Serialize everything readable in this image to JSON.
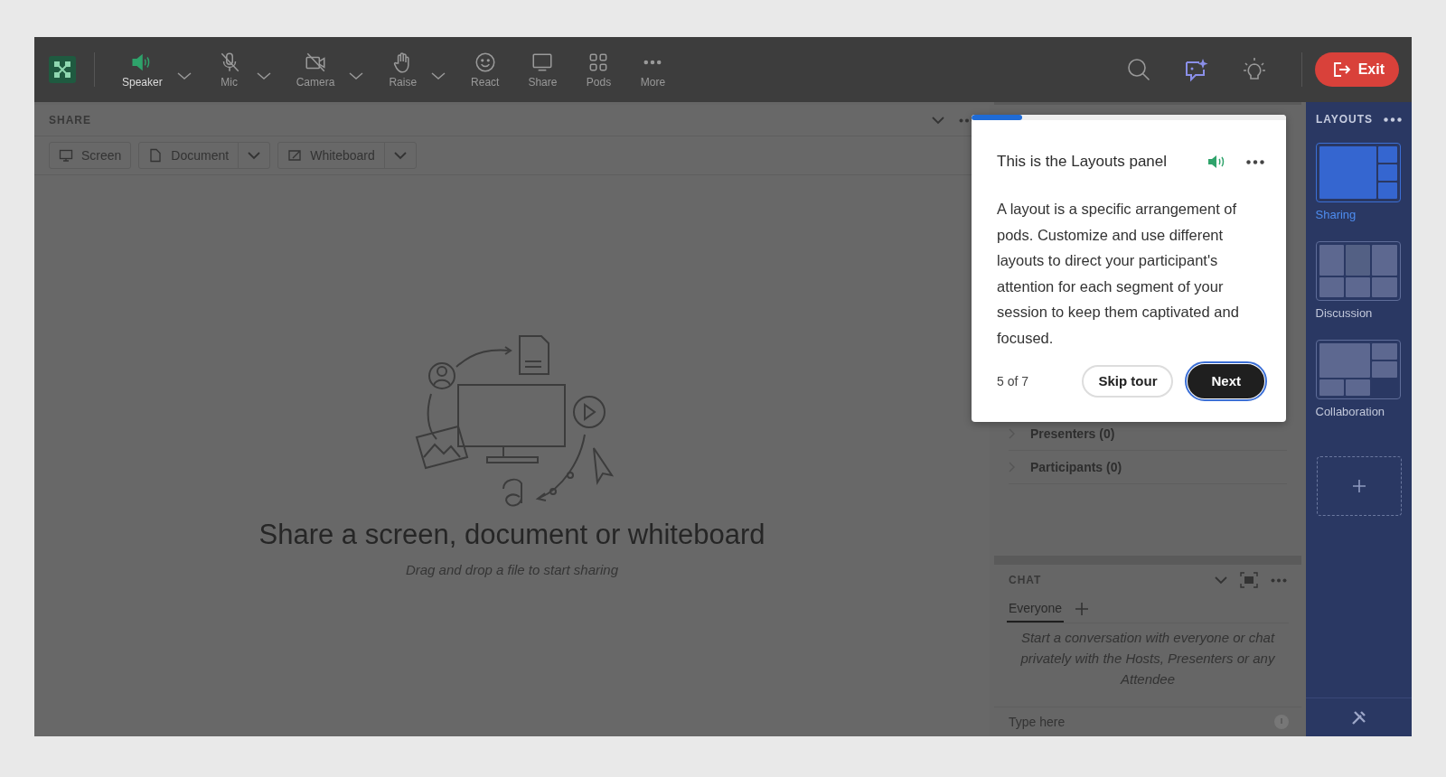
{
  "toolbar": {
    "items": [
      {
        "label": "Speaker",
        "kind": "speaker",
        "on": true,
        "dropdown": true
      },
      {
        "label": "Mic",
        "kind": "mic",
        "on": false,
        "dropdown": true
      },
      {
        "label": "Camera",
        "kind": "camera",
        "on": false,
        "dropdown": true
      },
      {
        "label": "Raise",
        "kind": "raise",
        "dropdown": true
      },
      {
        "label": "React",
        "kind": "react",
        "dropdown": false
      },
      {
        "label": "Share",
        "kind": "share",
        "dropdown": false
      },
      {
        "label": "Pods",
        "kind": "pods",
        "dropdown": false
      },
      {
        "label": "More",
        "kind": "more",
        "dropdown": false
      }
    ],
    "exit_button": "Exit"
  },
  "share_pod": {
    "title": "SHARE",
    "buttons": [
      {
        "label": "Screen",
        "kind": "monitor",
        "dropdown": false
      },
      {
        "label": "Document",
        "kind": "document",
        "dropdown": true
      },
      {
        "label": "Whiteboard",
        "kind": "whiteboard",
        "dropdown": true
      }
    ],
    "heading": "Share a screen, document or whiteboard",
    "hint": "Drag and drop a file to start sharing"
  },
  "attendees": {
    "groups": [
      {
        "label": "Presenters (0)"
      },
      {
        "label": "Participants (0)"
      }
    ]
  },
  "chat_pod": {
    "title": "CHAT",
    "tabs": [
      {
        "label": "Everyone",
        "selected": true
      }
    ],
    "empty_message": "Start a conversation with everyone or chat privately with the Hosts, Presenters or any Attendee",
    "input": {
      "placeholder": "Type here"
    }
  },
  "layouts_panel": {
    "title": "LAYOUTS",
    "items": [
      {
        "name": "Sharing",
        "kind": "sharing",
        "selected": true
      },
      {
        "name": "Discussion",
        "kind": "discussion",
        "selected": false
      },
      {
        "name": "Collaboration",
        "kind": "collaboration",
        "selected": false
      }
    ]
  },
  "tour_popover": {
    "progress": {
      "level": 0.16
    },
    "title": "This is the Layouts panel",
    "body": "A layout is a specific arrangement of pods. Customize and use different layouts to direct your participant's attention for each segment of your session to keep them captivated and focused.",
    "step": "5 of 7",
    "buttons": [
      "Skip tour",
      "Next"
    ]
  }
}
